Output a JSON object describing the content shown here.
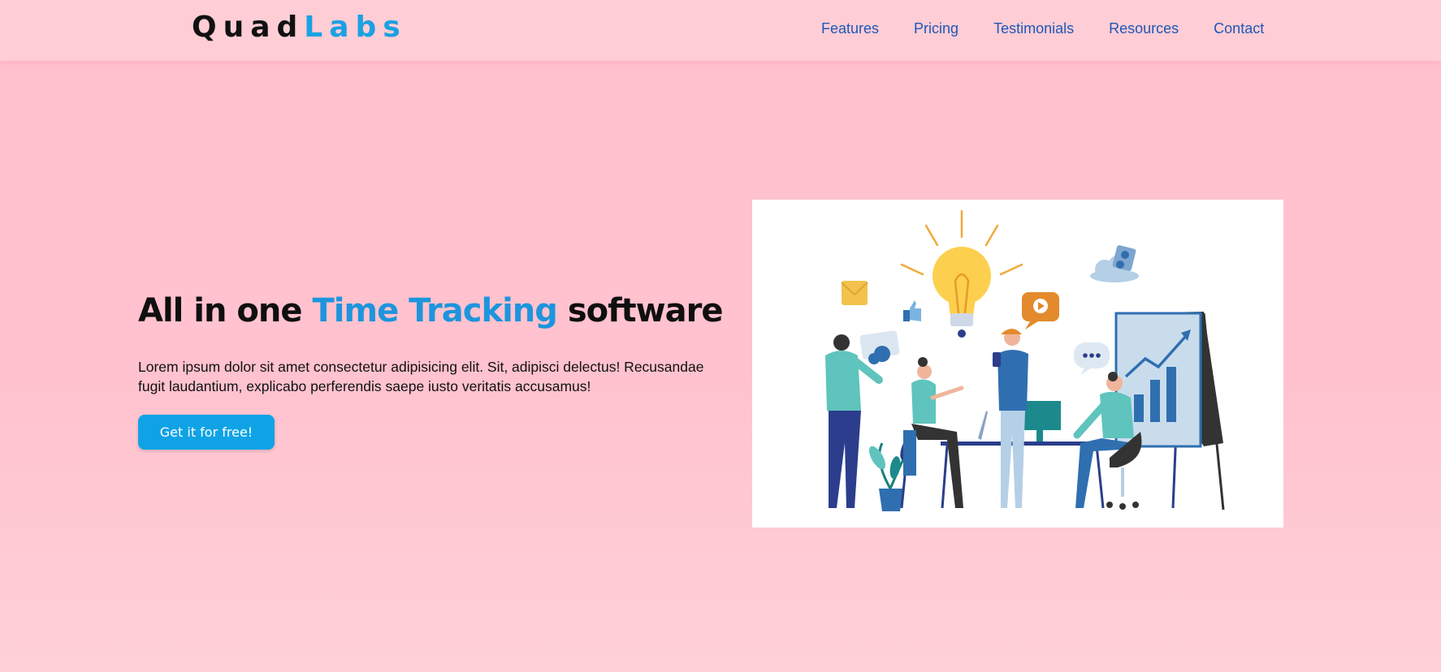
{
  "header": {
    "logo_part1": "Quad",
    "logo_part2": "Labs",
    "nav": [
      "Features",
      "Pricing",
      "Testimonials",
      "Resources",
      "Contact"
    ]
  },
  "hero": {
    "title_before": "All in one ",
    "title_highlight": "Time Tracking",
    "title_after": " software",
    "description": "Lorem ipsum dolor sit amet consectetur adipisicing elit. Sit, adipisci delectus! Recusandae fugit laudantium, explicabo perferendis saepe iusto veritatis accusamus!",
    "cta_label": "Get it for free!"
  },
  "colors": {
    "background": "#ffc1cd",
    "accent": "#1d95dd",
    "nav_link": "#1f57b8",
    "button": "#0fa3e6"
  },
  "illustration": {
    "icons": [
      "lightbulb-icon",
      "mail-icon",
      "thumbs-up-icon",
      "video-chat-icon",
      "cloud-user-icon",
      "typing-bubble-icon",
      "growth-chart-icon"
    ]
  }
}
